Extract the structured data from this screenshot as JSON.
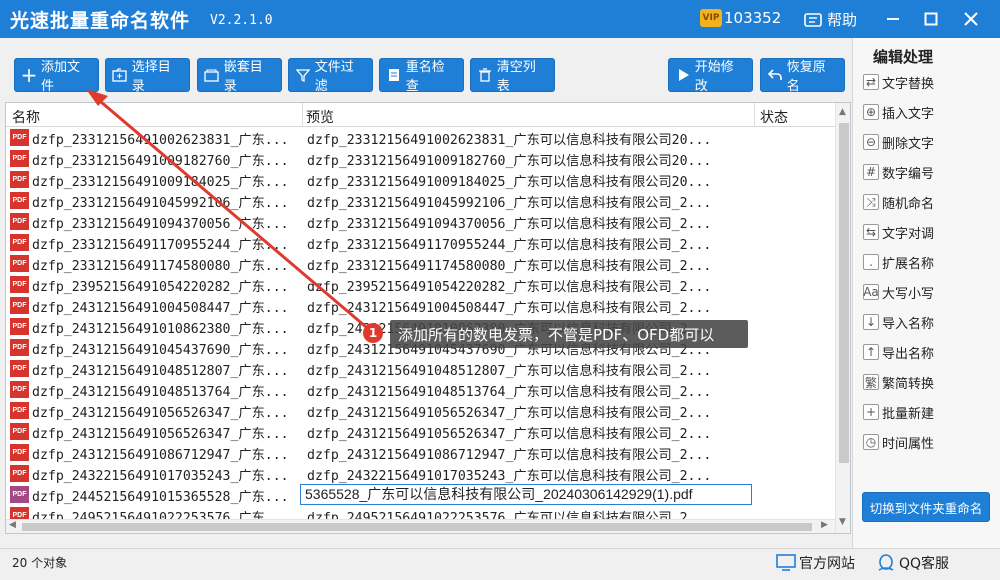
{
  "titlebar": {
    "app_title": "光速批量重命名软件",
    "version": "V2.2.1.0",
    "vip_number": "103352",
    "help_label": "帮助"
  },
  "toolbar": {
    "add_file": "添加文件",
    "choose_dir": "选择目录",
    "nested_dir": "嵌套目录",
    "file_filter": "文件过滤",
    "rename_check": "重名检查",
    "clear_list": "清空列表",
    "start_modify": "开始修改",
    "restore_name": "恢复原名"
  },
  "columns": {
    "name": "名称",
    "preview": "预览",
    "status": "状态"
  },
  "rows": [
    {
      "name": "dzfp_23312156491002623831_广东...",
      "preview": "dzfp_23312156491002623831_广东可以信息科技有限公司20..."
    },
    {
      "name": "dzfp_23312156491009182760_广东...",
      "preview": "dzfp_23312156491009182760_广东可以信息科技有限公司20..."
    },
    {
      "name": "dzfp_23312156491009184025_广东...",
      "preview": "dzfp_23312156491009184025_广东可以信息科技有限公司20..."
    },
    {
      "name": "dzfp_23312156491045992106_广东...",
      "preview": "dzfp_23312156491045992106_广东可以信息科技有限公司_2..."
    },
    {
      "name": "dzfp_23312156491094370056_广东...",
      "preview": "dzfp_23312156491094370056_广东可以信息科技有限公司_2..."
    },
    {
      "name": "dzfp_23312156491170955244_广东...",
      "preview": "dzfp_23312156491170955244_广东可以信息科技有限公司_2..."
    },
    {
      "name": "dzfp_23312156491174580080_广东...",
      "preview": "dzfp_23312156491174580080_广东可以信息科技有限公司_2..."
    },
    {
      "name": "dzfp_23952156491054220282_广东...",
      "preview": "dzfp_23952156491054220282_广东可以信息科技有限公司_2..."
    },
    {
      "name": "dzfp_24312156491004508447_广东...",
      "preview": "dzfp_24312156491004508447_广东可以信息科技有限公司_2..."
    },
    {
      "name": "dzfp_24312156491010862380_广东...",
      "preview": "dzfp_24312156491010862380_广东可以信息科技有限公司_2..."
    },
    {
      "name": "dzfp_24312156491045437690_广东...",
      "preview": "dzfp_24312156491045437690_广东可以信息科技有限公司_2..."
    },
    {
      "name": "dzfp_24312156491048512807_广东...",
      "preview": "dzfp_24312156491048512807_广东可以信息科技有限公司_2..."
    },
    {
      "name": "dzfp_24312156491048513764_广东...",
      "preview": "dzfp_24312156491048513764_广东可以信息科技有限公司_2..."
    },
    {
      "name": "dzfp_24312156491056526347_广东...",
      "preview": "dzfp_24312156491056526347_广东可以信息科技有限公司_2..."
    },
    {
      "name": "dzfp_24312156491056526347_广东...",
      "preview": "dzfp_24312156491056526347_广东可以信息科技有限公司_2..."
    },
    {
      "name": "dzfp_24312156491086712947_广东...",
      "preview": "dzfp_24312156491086712947_广东可以信息科技有限公司_2..."
    },
    {
      "name": "dzfp_24322156491017035243_广东...",
      "preview": "dzfp_24322156491017035243_广东可以信息科技有限公司_2..."
    },
    {
      "name": "dzfp_24452156491015365528_广东...",
      "preview": "5365528_广东可以信息科技有限公司_20240306142929(1).pdf",
      "editing": true
    },
    {
      "name": "dzfp_24952156491022253576_广东...",
      "preview": "dzfp_24952156491022253576_广东可以信息科技有限公司_2..."
    }
  ],
  "right_panel": {
    "title": "编辑处理",
    "items": [
      "文字替换",
      "插入文字",
      "删除文字",
      "数字编号",
      "随机命名",
      "文字对调",
      "扩展名称",
      "大写小写",
      "导入名称",
      "导出名称",
      "繁简转换",
      "批量新建",
      "时间属性"
    ],
    "switch_button": "切换到文件夹重命名"
  },
  "status": {
    "count": "20 个对象",
    "official_site": "官方网站",
    "qq_service": "QQ客服"
  },
  "annotation": {
    "step": "1",
    "text": "添加所有的数电发票，不管是PDF、OFD都可以"
  },
  "colors": {
    "primary": "#1f7fd6",
    "annotation_red": "#e03a2e"
  }
}
